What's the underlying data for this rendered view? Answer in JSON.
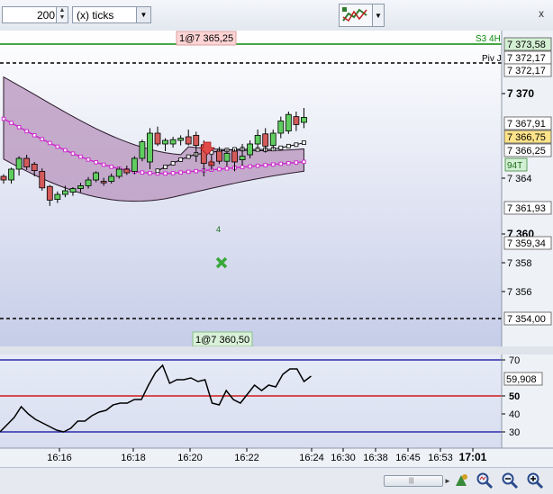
{
  "toolbar": {
    "period_value": "200",
    "period_type": "(x) ticks",
    "indicator_button": "indicators",
    "close_glyph": "x"
  },
  "main_chart": {
    "top_label": "1@7 365,25",
    "bottom_label": "1@7 360,50",
    "s3_label": "S3 4H",
    "piv_label": "Piv J",
    "count_label": "94T",
    "arrow_label": "4",
    "marker_label": "4"
  },
  "colors": {
    "up_candle": "#5fcd5f",
    "down_candle": "#d45a5a",
    "band_fill": "#bd9dc3",
    "slow_ma": "#cc2ecc",
    "fast_ma": "#ffffff",
    "rsi_line": "#000000",
    "level_70": "#2c2caa",
    "level_50": "#d11a1a",
    "level_30": "#2c2caa",
    "s3_line": "#0a8a0a",
    "background_top": "#ffffff",
    "background_bottom": "#c6cde8"
  },
  "chart_data": [
    {
      "type": "candlestick",
      "y_ticks": [
        "7 370",
        "7 364",
        "7 360",
        "7 358",
        "7 356"
      ],
      "price_labels": [
        "7 373,58",
        "7 372,17",
        "7 372,17",
        "7 367,91",
        "7 366,75",
        "7 366,25",
        "7 361,93",
        "7 359,34",
        "7 354,00"
      ],
      "x_ticks": [
        "16:16",
        "16:18",
        "16:20",
        "16:22",
        "16:24",
        "16:30",
        "16:38",
        "16:45",
        "16:53",
        "17:01"
      ],
      "ohlc": [
        [
          7358.5,
          7358.8,
          7357.5,
          7358.0
        ],
        [
          7358.0,
          7359.7,
          7357.5,
          7359.5
        ],
        [
          7359.5,
          7361.3,
          7358.6,
          7361.0
        ],
        [
          7361.0,
          7361.5,
          7359.4,
          7359.8
        ],
        [
          7360.2,
          7360.5,
          7358.5,
          7359.3
        ],
        [
          7359.2,
          7359.6,
          7356.5,
          7356.9
        ],
        [
          7357.1,
          7357.3,
          7354.4,
          7355.2
        ],
        [
          7355.3,
          7356.4,
          7354.8,
          7356.0
        ],
        [
          7356.0,
          7357.2,
          7355.6,
          7356.5
        ],
        [
          7356.3,
          7357.0,
          7355.8,
          7356.8
        ],
        [
          7356.8,
          7357.6,
          7356.3,
          7357.2
        ],
        [
          7357.2,
          7358.4,
          7356.8,
          7358.0
        ],
        [
          7358.0,
          7359.2,
          7357.7,
          7359.0
        ],
        [
          7357.8,
          7358.3,
          7357.2,
          7357.6
        ],
        [
          7357.8,
          7358.9,
          7357.5,
          7358.5
        ],
        [
          7358.5,
          7359.8,
          7358.2,
          7359.5
        ],
        [
          7359.5,
          7360.0,
          7358.7,
          7359.0
        ],
        [
          7359.2,
          7361.3,
          7358.8,
          7361.0
        ],
        [
          7361.0,
          7363.6,
          7360.6,
          7363.3
        ],
        [
          7360.5,
          7365.2,
          7359.5,
          7364.5
        ],
        [
          7364.5,
          7365.4,
          7362.7,
          7363.0
        ],
        [
          7363.0,
          7363.8,
          7362.0,
          7363.5
        ],
        [
          7363.0,
          7364.0,
          7362.5,
          7363.6
        ],
        [
          7363.5,
          7364.2,
          7362.8,
          7363.8
        ],
        [
          7364.0,
          7365.0,
          7362.8,
          7363.0
        ],
        [
          7364.2,
          7364.7,
          7360.5,
          7362.8
        ],
        [
          7362.9,
          7363.5,
          7358.5,
          7360.3
        ],
        [
          7360.5,
          7361.5,
          7359.3,
          7360.0
        ],
        [
          7362.0,
          7362.6,
          7360.2,
          7360.6
        ],
        [
          7360.6,
          7362.3,
          7359.9,
          7361.7
        ],
        [
          7362.0,
          7362.3,
          7359.2,
          7360.5
        ],
        [
          7360.8,
          7363.0,
          7360.0,
          7361.3
        ],
        [
          7361.5,
          7363.5,
          7361.0,
          7363.0
        ],
        [
          7363.0,
          7365.0,
          7362.2,
          7364.2
        ],
        [
          7364.4,
          7365.2,
          7361.8,
          7362.7
        ],
        [
          7362.8,
          7365.0,
          7362.2,
          7364.5
        ],
        [
          7364.5,
          7366.8,
          7363.8,
          7366.2
        ],
        [
          7364.8,
          7367.5,
          7364.4,
          7367.1
        ],
        [
          7366.8,
          7367.5,
          7364.8,
          7365.7
        ],
        [
          7366.0,
          7368.0,
          7365.2,
          7366.7
        ]
      ]
    },
    {
      "type": "line",
      "y_ticks": [
        "70",
        "50",
        "40",
        "30"
      ],
      "current_value_label": "59,908",
      "levels": [
        70,
        50,
        30
      ],
      "values": [
        30,
        34,
        38,
        44,
        40,
        37,
        35,
        33,
        31,
        30,
        32,
        36,
        36,
        39,
        41,
        42,
        45,
        46,
        46,
        48,
        48,
        56,
        63,
        67,
        57,
        59,
        59,
        60,
        58,
        59,
        46,
        45,
        53,
        48,
        46,
        51,
        56,
        53,
        56,
        55,
        62,
        65,
        65,
        58,
        61
      ]
    }
  ]
}
